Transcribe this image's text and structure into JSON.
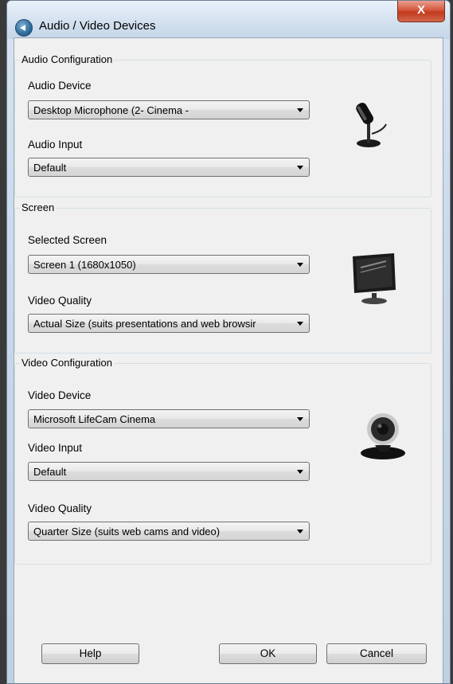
{
  "window": {
    "title": "Audio / Video Devices",
    "close_label": "X"
  },
  "audio": {
    "legend": "Audio Configuration",
    "device_label": "Audio Device",
    "device_value": "Desktop Microphone (2- Cinema -",
    "input_label": "Audio Input",
    "input_value": "Default"
  },
  "screen": {
    "legend": "Screen",
    "selected_label": "Selected Screen",
    "selected_value": "Screen 1 (1680x1050)",
    "quality_label": "Video Quality",
    "quality_value": "Actual Size (suits presentations and web browsir"
  },
  "video": {
    "legend": "Video Configuration",
    "device_label": "Video Device",
    "device_value": "Microsoft LifeCam Cinema",
    "input_label": "Video Input",
    "input_value": "Default",
    "quality_label": "Video Quality",
    "quality_value": "Quarter Size (suits web cams and video)"
  },
  "buttons": {
    "help": "Help",
    "ok": "OK",
    "cancel": "Cancel"
  },
  "icons": {
    "app": "app-logo-icon",
    "microphone": "microphone-icon",
    "monitor": "monitor-icon",
    "webcam": "webcam-icon"
  }
}
